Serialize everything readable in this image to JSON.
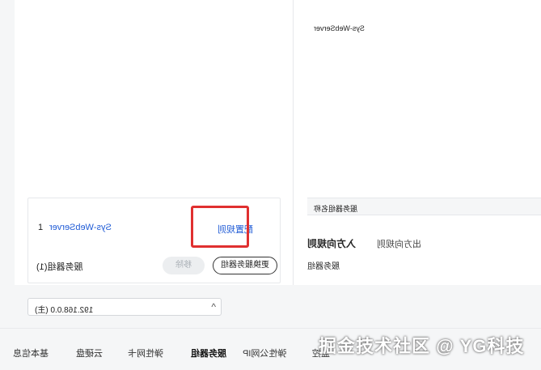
{
  "right_panel": {
    "server_title": "Sys-WebServer",
    "group_bar_label": "服务器组名称",
    "tab_active": "入方向规则",
    "tab_inactive": "出方向规则",
    "bottom_label": "服务器组"
  },
  "card": {
    "index": "1",
    "server_name": "Sys-WebServer",
    "edit_link": "配置规则",
    "footer_label": "服务器组(1)",
    "btn_disabled": "移除",
    "btn_outline": "更换服务器组"
  },
  "select": {
    "value": "192.168.0.0 (主)",
    "chevron": "^"
  },
  "bottom_tabs": [
    "基本信息",
    "云硬盘",
    "弹性网卡",
    "服务器组",
    "弹性公网IP",
    "监控"
  ],
  "active_tab_index": 3,
  "watermark": "掘金技术社区 @ YG科技"
}
